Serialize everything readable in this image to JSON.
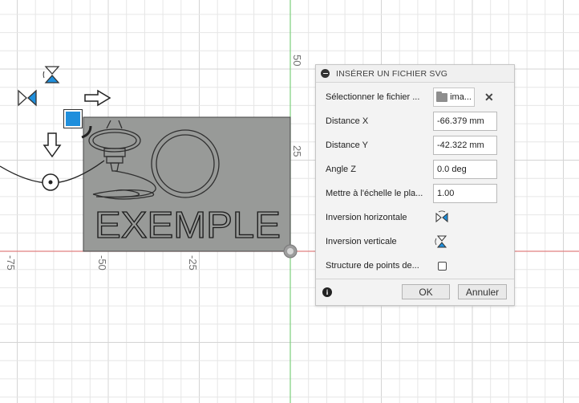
{
  "viewport": {
    "axis_ticks": [
      "-75",
      "-50",
      "-25",
      "50",
      "25"
    ],
    "sketch_text": "EXEMPLE"
  },
  "dialog": {
    "title": "INSÉRER UN FICHIER SVG",
    "rows": {
      "select_file": {
        "label": "Sélectionner le fichier ...",
        "file_button_label": "ima..."
      },
      "distance_x": {
        "label": "Distance X",
        "value": "-66.379 mm"
      },
      "distance_y": {
        "label": "Distance Y",
        "value": "-42.322 mm"
      },
      "angle_z": {
        "label": "Angle Z",
        "value": "0.0 deg"
      },
      "scale": {
        "label": "Mettre à l'échelle le pla...",
        "value": "1.00"
      },
      "flip_h": {
        "label": "Inversion horizontale"
      },
      "flip_v": {
        "label": "Inversion verticale"
      },
      "point_structure": {
        "label": "Structure de points de..."
      }
    },
    "footer": {
      "ok_label": "OK",
      "cancel_label": "Annuler",
      "info_glyph": "i"
    }
  },
  "colors": {
    "grid_minor": "#e6e6e6",
    "grid_major": "#d4d4d4",
    "axis_green": "#7ccf7c",
    "axis_red": "#e08080",
    "svg_fill": "#989a98",
    "gizmo_blue": "#1f8fdc"
  },
  "icons": [
    "flip-horizontal-icon",
    "flip-vertical-icon",
    "folder-icon",
    "close-icon",
    "info-icon",
    "collapse-icon"
  ]
}
